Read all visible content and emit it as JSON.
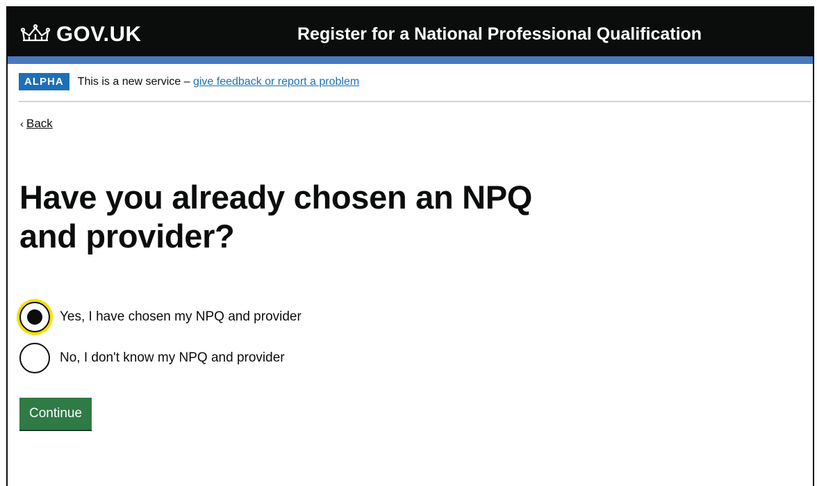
{
  "header": {
    "logo_text": "GOV.UK",
    "logo_icon": "crown-icon",
    "service_name": "Register for a National Professional Qualification",
    "background_color": "#0b0c0c",
    "accent_color": "#4a79c0"
  },
  "phase_banner": {
    "tag": "ALPHA",
    "text": "This is a new service – ",
    "link_text": "give feedback or report a problem",
    "tag_color": "#1d70b8"
  },
  "back_link": {
    "label": "Back",
    "icon": "chevron-left-icon"
  },
  "question": {
    "heading": "Have you already chosen an NPQ and provider?",
    "options": [
      {
        "label": "Yes, I have chosen my NPQ and provider",
        "checked": true
      },
      {
        "label": "No, I don't know my NPQ and provider",
        "checked": false
      }
    ]
  },
  "actions": {
    "continue_label": "Continue",
    "button_color": "#2f7a45"
  }
}
